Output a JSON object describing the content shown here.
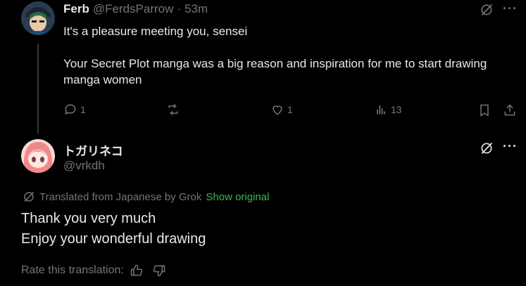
{
  "reply": {
    "author_name": "Ferb",
    "handle": "@FerdsParrow",
    "separator": "·",
    "time": "53m",
    "text": "It's a pleasure meeting you, sensei\n\nYour Secret Plot manga was a big reason and inspiration for me to start drawing manga women",
    "actions": {
      "replies": "1",
      "reposts": "",
      "likes": "1",
      "views": "13"
    }
  },
  "original": {
    "author_name": "トガリネコ",
    "handle": "@vrkdh",
    "translation_note": "Translated from Japanese by Grok",
    "show_original": "Show original",
    "text_line1": "Thank you very much",
    "text_line2": "Enjoy your wonderful drawing",
    "rate_label": "Rate this translation:"
  },
  "colors": {
    "background": "#000000",
    "text": "#e7e9ea",
    "muted": "#71767b",
    "link": "#3fb950"
  }
}
